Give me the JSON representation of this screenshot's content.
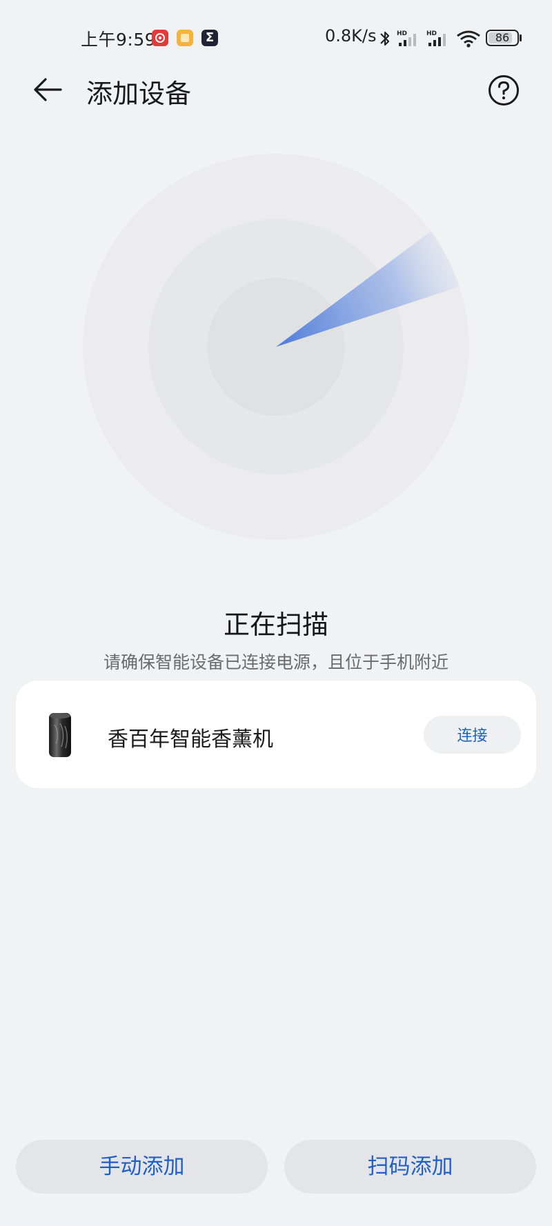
{
  "status_bar": {
    "time": "上午9:59",
    "network_speed": "0.8K/s",
    "battery_level": "86",
    "notification_icons": [
      "netease-music-icon",
      "notes-icon",
      "sigma-icon"
    ],
    "sigma_glyph": "Σ"
  },
  "header": {
    "title": "添加设备",
    "back_icon": "back-arrow-icon",
    "help_icon": "help-icon"
  },
  "scan": {
    "title": "正在扫描",
    "hint": "请确保智能设备已连接电源，且位于手机附近"
  },
  "device": {
    "name": "香百年智能香薰机",
    "connect_label": "连接"
  },
  "bottom": {
    "manual_label": "手动添加",
    "scan_label": "扫码添加"
  },
  "colors": {
    "accent": "#1f5fc6",
    "background": "#f1f2f4",
    "card": "#ffffff"
  }
}
